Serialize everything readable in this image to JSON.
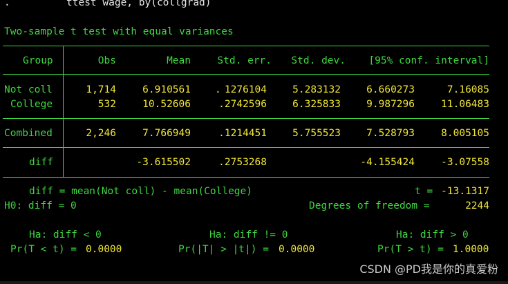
{
  "command": {
    "prompt": ".",
    "text": "ttest wage, by(collgrad)"
  },
  "test_title": "Two-sample t test with equal variances",
  "table": {
    "headers": [
      "Group",
      "Obs",
      "Mean",
      "Std. err.",
      "Std. dev.",
      "[95% conf. interval]"
    ],
    "rows": {
      "notcoll": {
        "group": "Not coll",
        "obs": "1,714",
        "mean": "6.910561",
        "se": "1276104",
        "sd": "5.283132",
        "lo": "6.660273",
        "hi": "7.16085"
      },
      "college": {
        "group": "College",
        "obs": "532",
        "mean": "10.52606",
        "se": ".2742596",
        "sd": "6.325833",
        "lo": "9.987296",
        "hi": "11.06483"
      },
      "combined": {
        "group": "Combined",
        "obs": "2,246",
        "mean": "7.766949",
        "se": ".1214451",
        "sd": "5.755523",
        "lo": "7.528793",
        "hi": "8.005105"
      },
      "diff": {
        "group": "diff",
        "mean": "-3.615502",
        "se": ".2753268",
        "lo": "-4.155424",
        "hi": "-3.07558"
      }
    }
  },
  "stats": {
    "diff_def": "diff = mean(Not coll) - mean(College)",
    "t_label": "t =",
    "t_value": "-13.1317",
    "h0": "H0: diff = 0",
    "df_label": "Degrees of freedom =",
    "df_value": "2244"
  },
  "hypotheses": [
    {
      "ha": "Ha: diff < 0",
      "p_label": "Pr(T < t) =",
      "p_value": "0.0000"
    },
    {
      "ha": "Ha: diff != 0",
      "p_label": "Pr(|T| > |t|) =",
      "p_value": "0.0000"
    },
    {
      "ha": "Ha: diff > 0",
      "p_label": "Pr(T > t) =",
      "p_value": "1.0000"
    }
  ],
  "watermark": "CSDN @PD我是你的真爱粉",
  "colors": {
    "background": "#000000",
    "label": "#3fd63f",
    "value": "#f0e635",
    "command": "#e8e8e8"
  }
}
